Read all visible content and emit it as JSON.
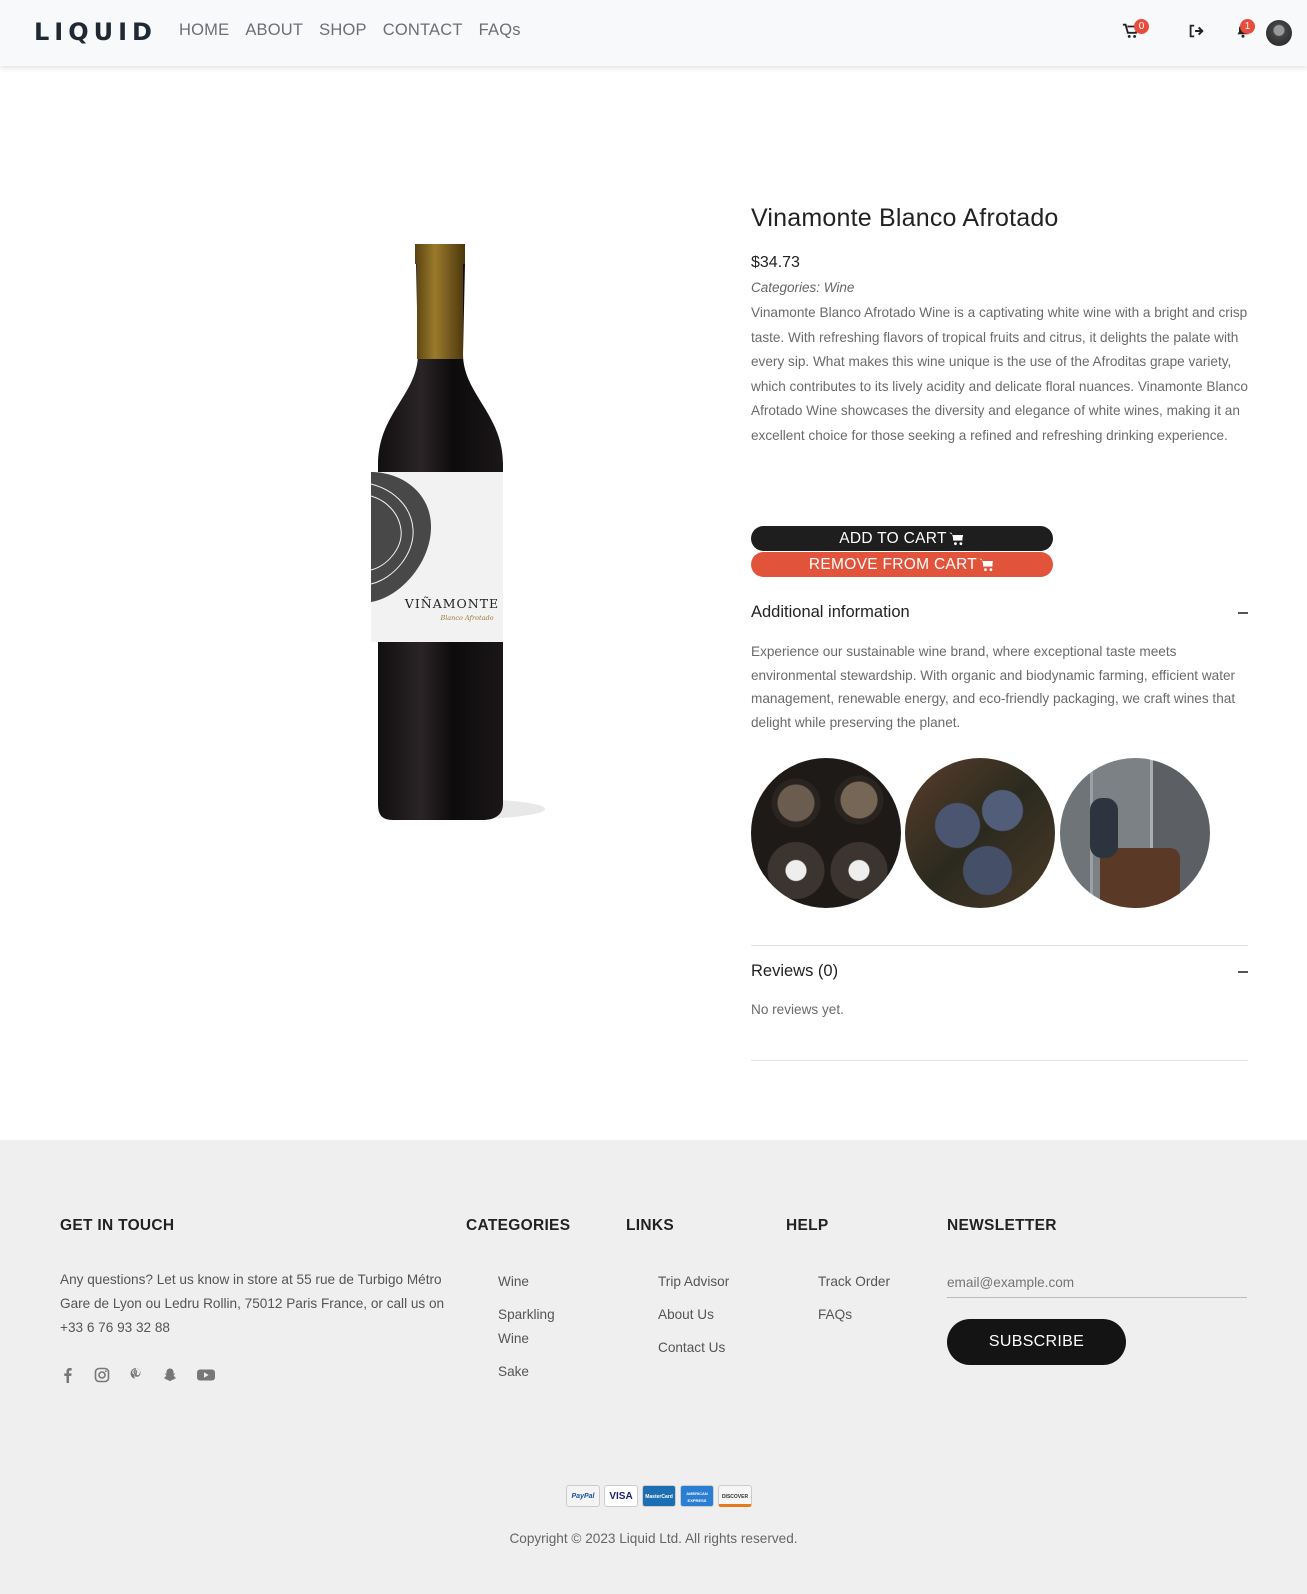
{
  "header": {
    "logo": "LIQUID",
    "nav": [
      "HOME",
      "ABOUT",
      "SHOP",
      "CONTACT",
      "FAQs"
    ],
    "cart_count": "0",
    "notification_count": "1"
  },
  "product": {
    "title": "Vinamonte Blanco Afrotado",
    "price": "$34.73",
    "categories": "Categories: Wine",
    "description": "Vinamonte Blanco Afrotado Wine is a captivating white wine with a bright and crisp taste. With refreshing flavors of tropical fruits and citrus, it delights the palate with every sip. What makes this wine unique is the use of the Afroditas grape variety, which contributes to its lively acidity and delicate floral nuances. Vinamonte Blanco Afrotado Wine showcases the diversity and elegance of white wines, making it an excellent choice for those seeking a refined and refreshing drinking experience.",
    "label_brand": "VIÑAMONTE",
    "label_sub": "Blanco Afrotado",
    "add_to_cart": "ADD TO CART",
    "remove_from_cart": "REMOVE FROM CART"
  },
  "additional_info": {
    "title": "Additional information",
    "text": "Experience our sustainable wine brand, where exceptional taste meets environmental stewardship. With organic and biodynamic farming, efficient water management, renewable energy, and eco-friendly packaging, we craft wines that delight while preserving the planet."
  },
  "reviews": {
    "title": "Reviews (0)",
    "empty": "No reviews yet."
  },
  "footer": {
    "get_in_touch": {
      "title": "GET IN TOUCH",
      "text": "Any questions? Let us know in store at 55 rue de Turbigo Métro Gare de Lyon ou Ledru Rollin, 75012 Paris France, or call us on +33 6 76 93 32 88"
    },
    "categories": {
      "title": "CATEGORIES",
      "items": [
        "Wine",
        "Sparkling Wine",
        "Sake"
      ]
    },
    "links": {
      "title": "LINKS",
      "items": [
        "Trip Advisor",
        "About Us",
        "Contact Us"
      ]
    },
    "help": {
      "title": "HELP",
      "items": [
        "Track Order",
        "FAQs"
      ]
    },
    "newsletter": {
      "title": "NEWSLETTER",
      "placeholder": "email@example.com",
      "button": "SUBSCRIBE"
    },
    "payments": [
      "PayPal",
      "VISA",
      "MasterCard",
      "AMERICAN EXPRESS",
      "DISCOVER"
    ],
    "copyright": "Copyright © 2023 Liquid Ltd. All rights reserved."
  },
  "colors": {
    "accent_red": "#e2533c",
    "dark": "#1e1e1e",
    "footer_bg": "#efefef"
  }
}
